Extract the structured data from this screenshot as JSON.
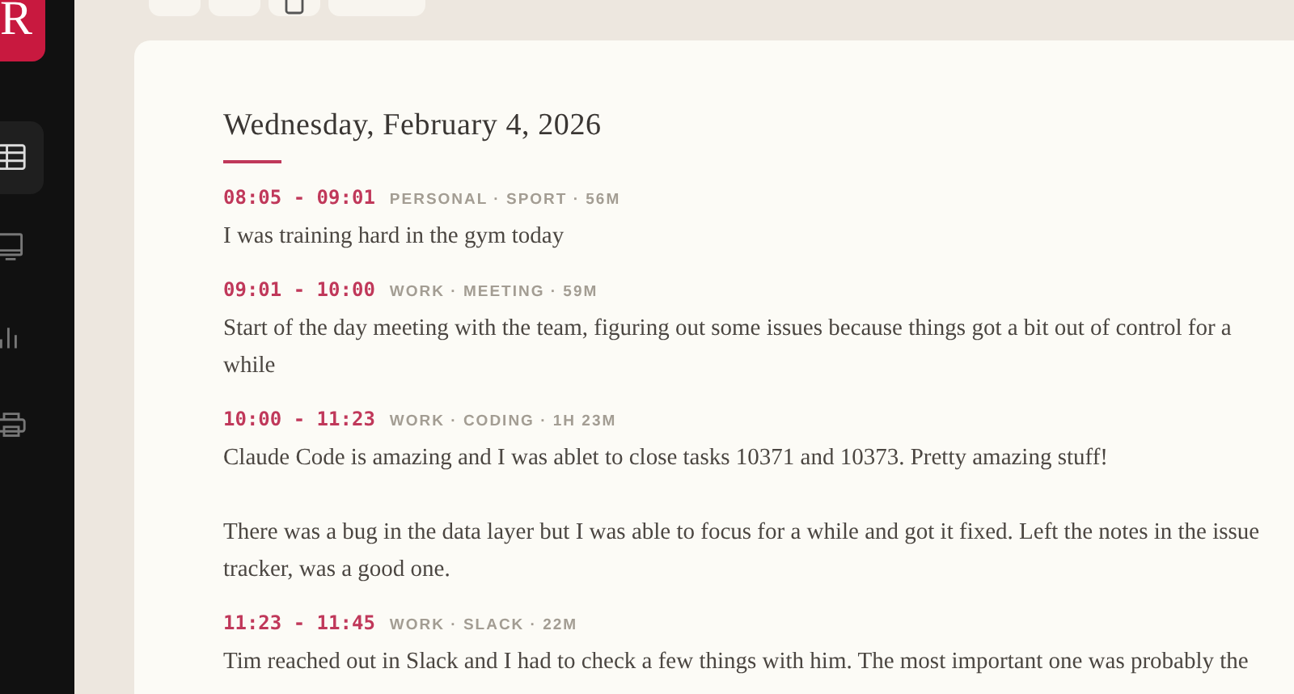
{
  "sidebar": {
    "logo": "R",
    "items": [
      {
        "selected": true
      },
      {
        "selected": false
      },
      {
        "selected": false
      },
      {
        "selected": false
      }
    ]
  },
  "toolbar": {
    "buttons": [
      {
        "kind": "plain"
      },
      {
        "kind": "plain"
      },
      {
        "kind": "icon"
      },
      {
        "kind": "wide"
      }
    ]
  },
  "day": {
    "title": "Wednesday, February 4, 2026",
    "entries": [
      {
        "time": "08:05 - 09:01",
        "meta": "PERSONAL · SPORT · 56M",
        "paragraphs": [
          "I was training hard in the gym today"
        ]
      },
      {
        "time": "09:01 - 10:00",
        "meta": "WORK · MEETING · 59M",
        "paragraphs": [
          "Start of the day meeting with the team, figuring out some issues because things got a bit out of control for a while"
        ]
      },
      {
        "time": "10:00 - 11:23",
        "meta": "WORK · CODING · 1H 23M",
        "paragraphs": [
          "Claude Code is amazing and I was ablet to close tasks 10371 and 10373. Pretty amazing stuff!",
          "There was a bug in the data layer but I was able to focus for a while and got it fixed. Left the notes in the issue tracker, was a good one."
        ]
      },
      {
        "time": "11:23 - 11:45",
        "meta": "WORK · SLACK · 22M",
        "paragraphs": [
          "Tim reached out in Slack and I had to check a few things with him. The most important one was probably the"
        ]
      }
    ]
  }
}
